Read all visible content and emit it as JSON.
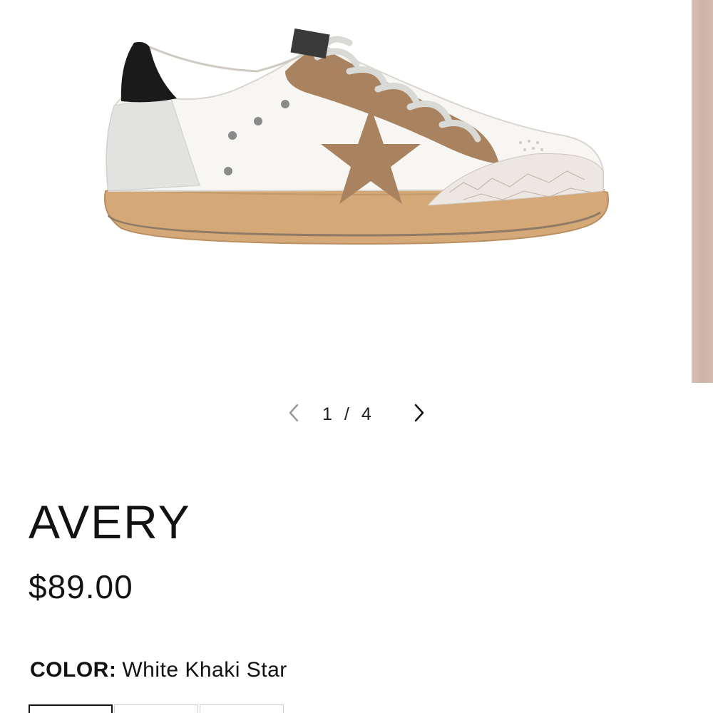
{
  "product": {
    "title": "AVERY",
    "price": "$89.00",
    "color_label": "COLOR:",
    "color_value": "White Khaki Star"
  },
  "gallery": {
    "current": "1",
    "separator": "/",
    "total": "4",
    "main_image": "product-sneaker-image",
    "prev_icon": "chevron-left-icon",
    "next_icon": "chevron-right-icon"
  },
  "swatches": {
    "count_visible": 3,
    "selected_index": 0
  },
  "colors": {
    "text": "#121212",
    "khaki": "#a98360",
    "sole": "#d4a877",
    "heel_black": "#1a1a1a",
    "peek": "#cdb3a5"
  }
}
